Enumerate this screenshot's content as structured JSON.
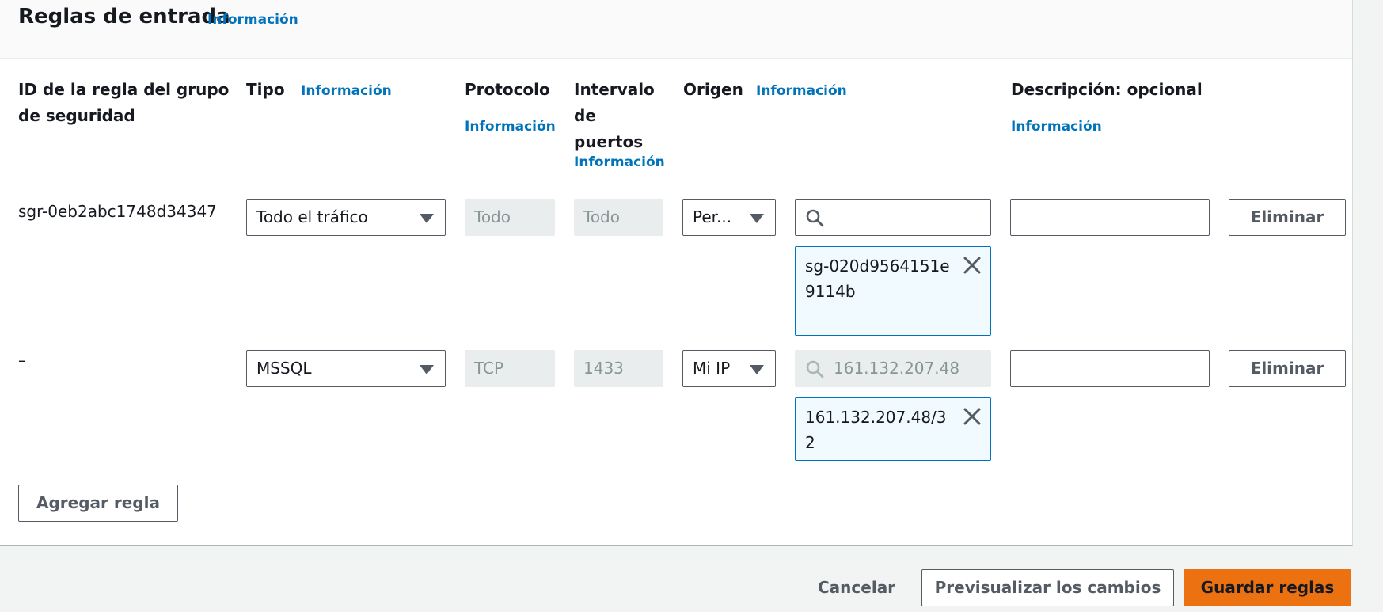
{
  "section": {
    "title": "Reglas de entrada",
    "info_label": "Información"
  },
  "columns": {
    "rule_id": "ID de la regla del grupo de seguridad",
    "type": "Tipo",
    "protocol": "Protocolo",
    "port_range": "Intervalo de puertos",
    "source": "Origen",
    "description": "Descripción: opcional",
    "info_label": "Información"
  },
  "rules": [
    {
      "id": "sgr-0eb2abc1748d34347",
      "type": "Todo el tráfico",
      "protocol": "Todo",
      "port_range": "Todo",
      "source": "Per...",
      "source_search_value": "",
      "source_token": "sg-020d9564151e9114b",
      "description": "",
      "delete_label": "Eliminar"
    },
    {
      "id": "–",
      "type": "MSSQL",
      "protocol": "TCP",
      "port_range": "1433",
      "source": "Mi IP",
      "source_search_placeholder": "161.132.207.48",
      "source_token": "161.132.207.48/32",
      "description": "",
      "delete_label": "Eliminar"
    }
  ],
  "add_rule_label": "Agregar regla",
  "footer": {
    "cancel_label": "Cancelar",
    "preview_label": "Previsualizar los cambios",
    "save_label": "Guardar reglas"
  },
  "colors": {
    "accent": "#ec7211",
    "link": "#0073bb",
    "token_bg": "#f1faff"
  }
}
